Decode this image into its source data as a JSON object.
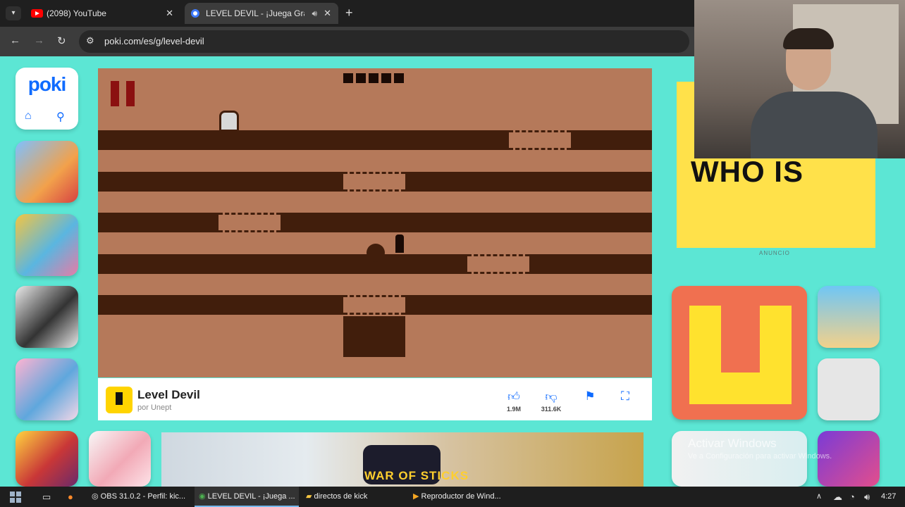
{
  "browser": {
    "tabs": [
      {
        "title": "(2098) YouTube",
        "close": "✕"
      },
      {
        "title": "LEVEL DEVIL - ¡Juega Gratis",
        "close": "✕"
      }
    ],
    "new_tab": "+",
    "url": "poki.com/es/g/level-devil"
  },
  "poki": {
    "logo": "poki"
  },
  "game": {
    "title": "Level Devil",
    "author": "por Unept",
    "likes": "1.9M",
    "dislikes": "311.6K"
  },
  "ads": {
    "label": "ANUNCIO",
    "right_ad_text": "WHO IS",
    "bottom_ad_text": "WAR OF STICKS"
  },
  "overlay": {
    "watermark_title": "Activar Windows",
    "watermark_sub": "Ve a Configuración para activar Windows."
  },
  "taskbar": {
    "items": [
      {
        "label": "OBS 31.0.2 - Perfil: kic..."
      },
      {
        "label": "LEVEL DEVIL - ¡Juega ..."
      },
      {
        "label": "directos de kick"
      },
      {
        "label": "Reproductor de Wind..."
      }
    ],
    "time": "4:27"
  },
  "colors": {
    "game_bg": "#b5795a",
    "game_dark": "#411e0c",
    "poki_blue": "#0f6bff",
    "page_bg": "#5ce6d4"
  }
}
